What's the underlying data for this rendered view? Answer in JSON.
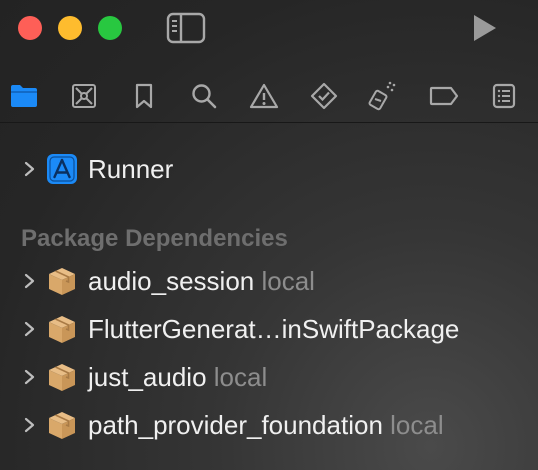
{
  "window": {
    "traffic_lights": [
      "close",
      "minimize",
      "zoom"
    ]
  },
  "navigator_tabs": [
    {
      "icon": "folder-icon",
      "active": true
    },
    {
      "icon": "source-control-icon",
      "active": false
    },
    {
      "icon": "bookmark-icon",
      "active": false
    },
    {
      "icon": "search-icon",
      "active": false
    },
    {
      "icon": "warning-icon",
      "active": false
    },
    {
      "icon": "test-diamond-icon",
      "active": false
    },
    {
      "icon": "debug-spray-icon",
      "active": false
    },
    {
      "icon": "breakpoint-icon",
      "active": false
    },
    {
      "icon": "report-icon",
      "active": false
    }
  ],
  "colors": {
    "accent": "#1b8af7",
    "package_icon": "#d9a86a",
    "muted_text": "#8d8d8d",
    "section_header": "#6e6e6e"
  },
  "tree": {
    "project": {
      "label": "Runner",
      "icon": "xcode-project-icon"
    },
    "section_title": "Package Dependencies",
    "packages": [
      {
        "name": "audio_session",
        "suffix": "local"
      },
      {
        "name": "FlutterGenerat…inSwiftPackage",
        "suffix": ""
      },
      {
        "name": "just_audio",
        "suffix": "local"
      },
      {
        "name": "path_provider_foundation",
        "suffix": "local"
      }
    ]
  }
}
